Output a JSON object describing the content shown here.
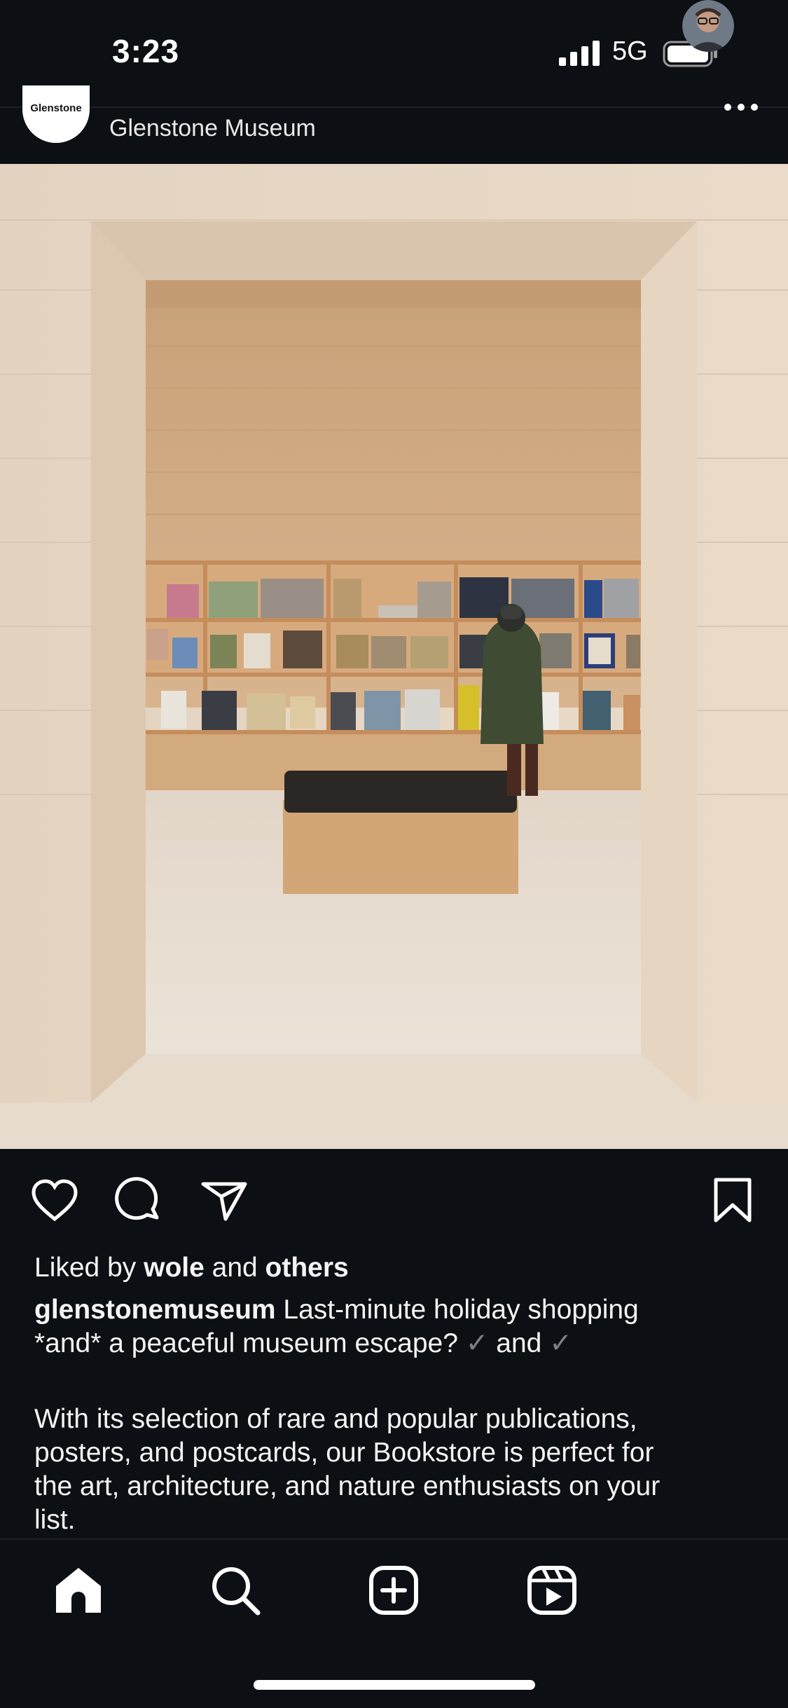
{
  "status_bar": {
    "time": "3:23",
    "network": "5G"
  },
  "post": {
    "account_subtitle": "Glenstone Museum",
    "logo_text": "Glenstone"
  },
  "actions": {
    "likes_prefix": "Liked by ",
    "liked_user": "wole",
    "likes_middle": " and ",
    "likes_suffix": "others"
  },
  "caption": {
    "username": "glenstonemuseum",
    "line1_text": " Last-minute holiday shopping",
    "line2_text": "*and* a peaceful museum escape?",
    "check": "✓",
    "and_word": "and",
    "paragraph_lines": [
      "With its selection of rare and popular publications,",
      "posters, and postcards, our Bookstore is perfect for",
      "the art, architecture, and nature enthusiasts on your",
      "list."
    ]
  },
  "icons": {
    "like": "heart-icon",
    "comment": "comment-icon",
    "share": "share-icon",
    "bookmark": "bookmark-icon",
    "home": "home-icon",
    "search": "search-icon",
    "create": "create-icon",
    "reels": "reels-icon"
  },
  "colors": {
    "background": "#0c0f14",
    "text": "#ffffff",
    "check": "#7c7f85"
  }
}
